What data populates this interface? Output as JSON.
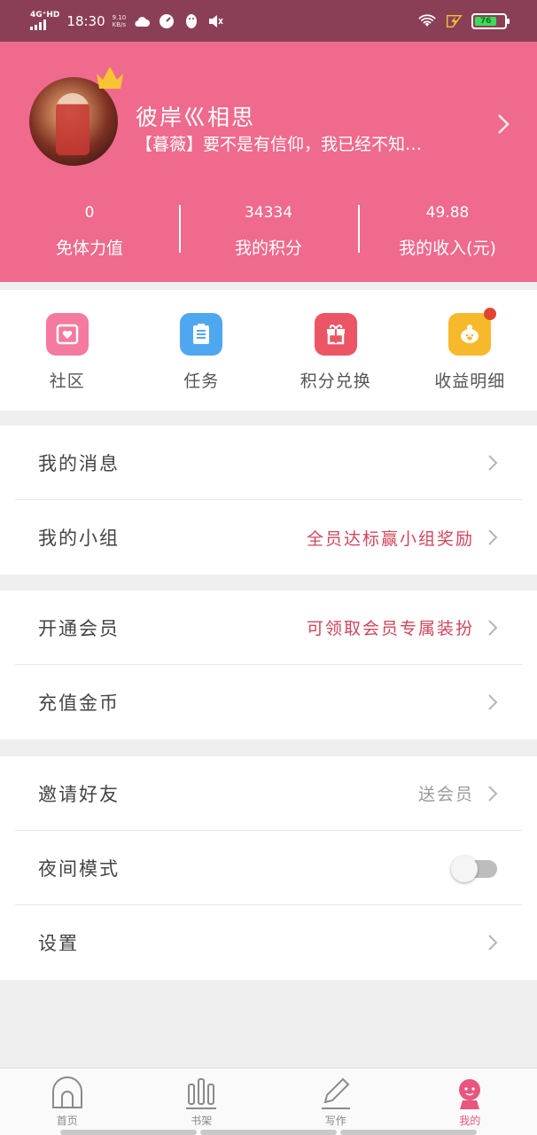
{
  "status_bar": {
    "network": "4G⁺HD",
    "time": "18:30",
    "speed_value": "9.10",
    "speed_unit": "KB/s",
    "battery": "76"
  },
  "profile": {
    "username": "彼岸巛相思",
    "signature": "【暮薇】要不是有信仰，我已经不知…",
    "stats": [
      {
        "value": "0",
        "label": "免体力值"
      },
      {
        "value": "34334",
        "label": "我的积分"
      },
      {
        "value": "49.88",
        "label": "我的收入(元)"
      }
    ]
  },
  "quick_actions": [
    {
      "label": "社区",
      "icon": "community-icon",
      "color": "#f47aa0"
    },
    {
      "label": "任务",
      "icon": "task-icon",
      "color": "#4fa8ef"
    },
    {
      "label": "积分兑换",
      "icon": "gift-icon",
      "color": "#ec5565"
    },
    {
      "label": "收益明细",
      "icon": "piggy-bank-icon",
      "color": "#f6b92b"
    }
  ],
  "menu": {
    "messages": "我的消息",
    "groups": "我的小组",
    "groups_hint": "全员达标赢小组奖励",
    "vip": "开通会员",
    "vip_hint": "可领取会员专属装扮",
    "recharge": "充值金币",
    "invite": "邀请好友",
    "invite_hint": "送会员",
    "night_mode": "夜间模式",
    "night_mode_on": false,
    "settings": "设置"
  },
  "tabs": [
    {
      "label": "首页",
      "icon": "home-icon"
    },
    {
      "label": "书架",
      "icon": "bookshelf-icon"
    },
    {
      "label": "写作",
      "icon": "pen-icon"
    },
    {
      "label": "我的",
      "icon": "profile-icon",
      "active": true
    }
  ],
  "colors": {
    "header": "#ef6a8c",
    "status_bar": "#8b3f57",
    "accent_red": "#d2455a",
    "active_tab": "#e8557d"
  }
}
